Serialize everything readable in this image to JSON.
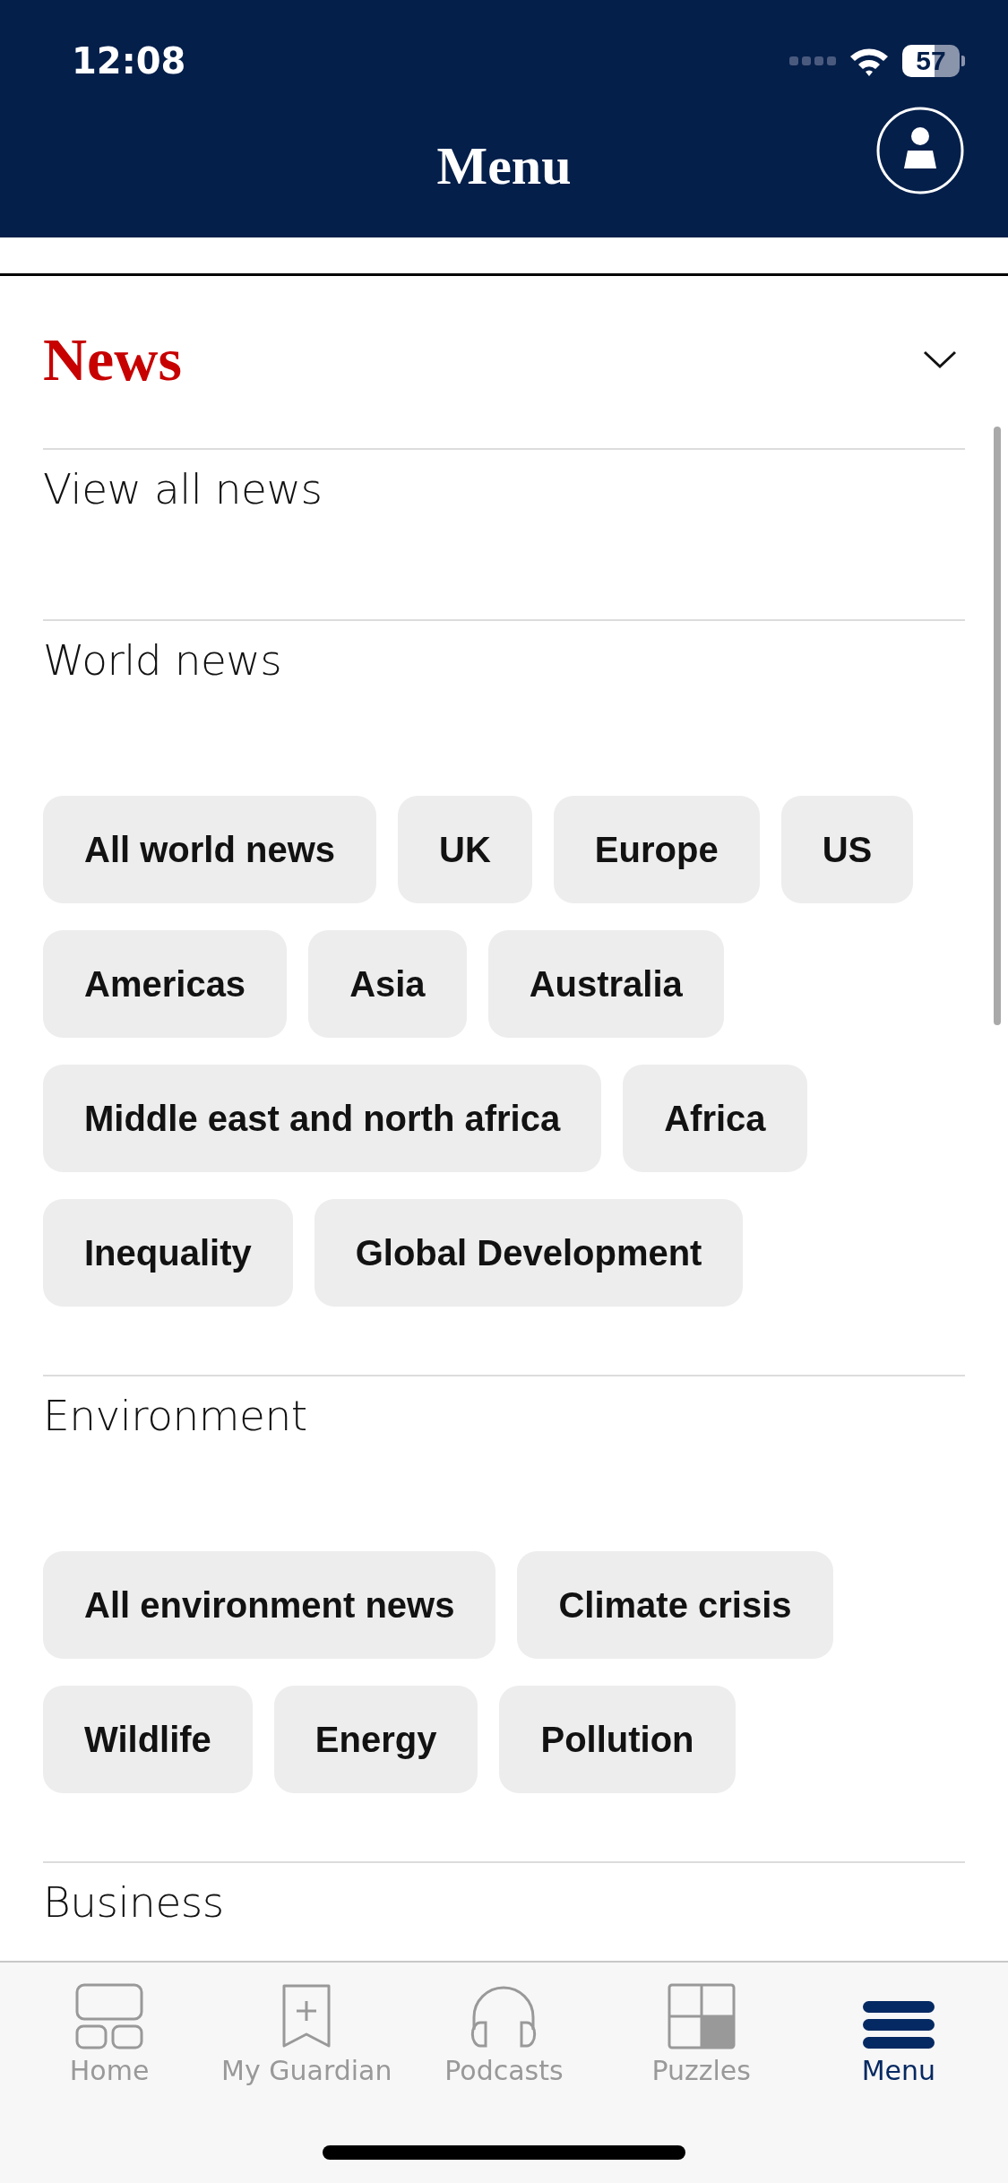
{
  "status_bar": {
    "time": "12:08",
    "battery": "57"
  },
  "header": {
    "title": "Menu"
  },
  "section": {
    "title": "News",
    "expanded": true
  },
  "groups": [
    {
      "title": "View all news"
    },
    {
      "title": "World news",
      "chips": [
        "All world news",
        "UK",
        "Europe",
        "US",
        "Americas",
        "Asia",
        "Australia",
        "Middle east and north africa",
        "Africa",
        "Inequality",
        "Global Development"
      ]
    },
    {
      "title": "Environment",
      "chips": [
        "All environment news",
        "Climate crisis",
        "Wildlife",
        "Energy",
        "Pollution"
      ]
    },
    {
      "title": "Business"
    }
  ],
  "tabs": [
    {
      "label": "Home",
      "kind": "home",
      "selected": false
    },
    {
      "label": "My Guardian",
      "kind": "bookmark",
      "selected": false
    },
    {
      "label": "Podcasts",
      "kind": "podcasts",
      "selected": false
    },
    {
      "label": "Puzzles",
      "kind": "puzzles",
      "selected": false
    },
    {
      "label": "Menu",
      "kind": "menu",
      "selected": true
    }
  ]
}
